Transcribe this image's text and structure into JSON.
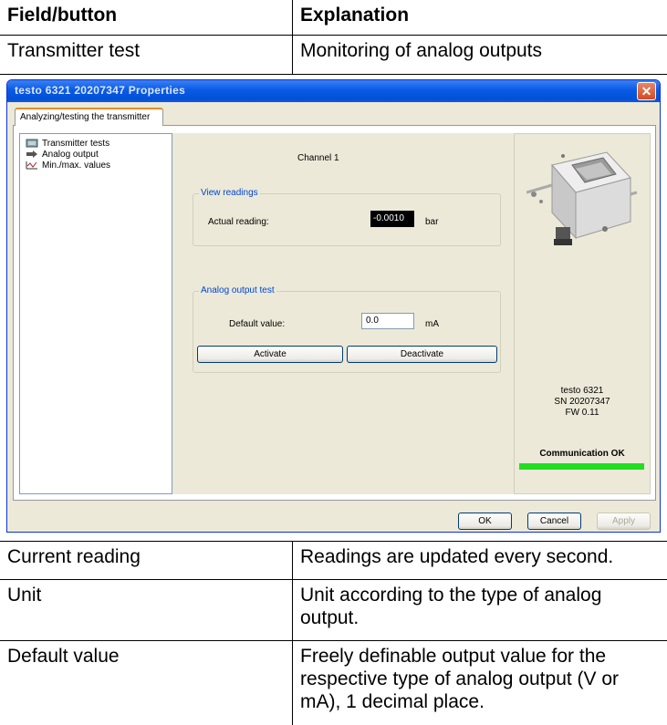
{
  "header_table": {
    "col1_header": "Field/button",
    "col2_header": "Explanation",
    "row": {
      "field": "Transmitter test",
      "explanation": "Monitoring of analog outputs"
    }
  },
  "dialog": {
    "title": "testo 6321  20207347 Properties",
    "close_label": "✕",
    "tab_label": "Analyzing/testing the transmitter",
    "tree": [
      {
        "label": "Transmitter tests",
        "icon": "transmitter-icon"
      },
      {
        "label": "Analog output",
        "icon": "analog-output-icon"
      },
      {
        "label": "Min./max. values",
        "icon": "min-max-icon"
      }
    ],
    "channel_label": "Channel 1",
    "view_readings": {
      "group_title": "View readings",
      "actual_reading_label": "Actual reading:",
      "actual_reading_value": "-0.0010",
      "unit": "bar"
    },
    "analog_output_test": {
      "group_title": "Analog output test",
      "default_value_label": "Default value:",
      "default_value": "0.0",
      "unit": "mA",
      "activate_label": "Activate",
      "deactivate_label": "Deactivate"
    },
    "device": {
      "model": "testo 6321",
      "serial": "SN 20207347",
      "firmware": "FW  0.11",
      "status": "Communication OK",
      "status_color": "#22dd22"
    },
    "buttons": {
      "ok": "OK",
      "cancel": "Cancel",
      "apply": "Apply"
    }
  },
  "explanation_table": [
    {
      "field": "Current reading",
      "explanation": "Readings are updated every second."
    },
    {
      "field": "Unit",
      "explanation": "Unit according to the type of analog output."
    },
    {
      "field": "Default value",
      "explanation": "Freely definable output value for the respective type of analog output (V or mA), 1 decimal place."
    }
  ]
}
